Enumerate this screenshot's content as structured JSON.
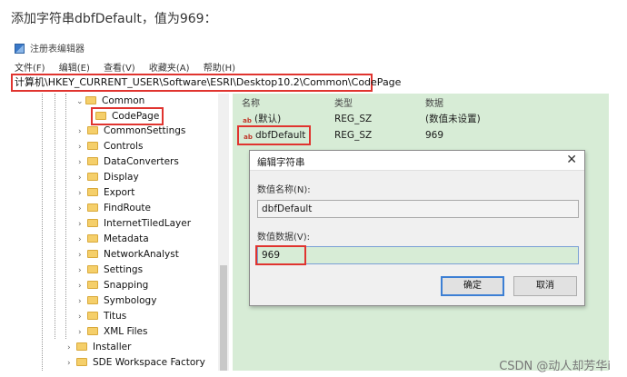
{
  "caption": "添加字符串dbfDefault，值为969：",
  "window": {
    "title": "注册表编辑器",
    "icon": "registry-icon"
  },
  "menu": [
    "文件(F)",
    "编辑(E)",
    "查看(V)",
    "收藏夹(A)",
    "帮助(H)"
  ],
  "address": "计算机\\HKEY_CURRENT_USER\\Software\\ESRI\\Desktop10.2\\Common\\CodePage",
  "tree": {
    "expanded": "Common",
    "selected": "CodePage",
    "children": [
      "CommonSettings",
      "Controls",
      "DataConverters",
      "Display",
      "Export",
      "FindRoute",
      "InternetTiledLayer",
      "Metadata",
      "NetworkAnalyst",
      "Settings",
      "Snapping",
      "Symbology",
      "Titus",
      "XML Files"
    ],
    "siblings": [
      "Installer",
      "SDE Workspace Factory"
    ]
  },
  "values_list": {
    "headers": {
      "name": "名称",
      "type": "类型",
      "data": "数据"
    },
    "rows": [
      {
        "name": "(默认)",
        "type": "REG_SZ",
        "data": "(数值未设置)"
      },
      {
        "name": "dbfDefault",
        "type": "REG_SZ",
        "data": "969"
      }
    ],
    "icon_text": "ab"
  },
  "dialog": {
    "title": "编辑字符串",
    "name_label": "数值名称(N):",
    "name_value": "dbfDefault",
    "data_label": "数值数据(V):",
    "data_value": "969",
    "ok": "确定",
    "cancel": "取消"
  },
  "watermark": "CSDN @动人却芳华i",
  "colors": {
    "highlight_red": "#e0342f",
    "pane_green": "#d7ecd6",
    "accent_blue": "#3c7fd4"
  }
}
